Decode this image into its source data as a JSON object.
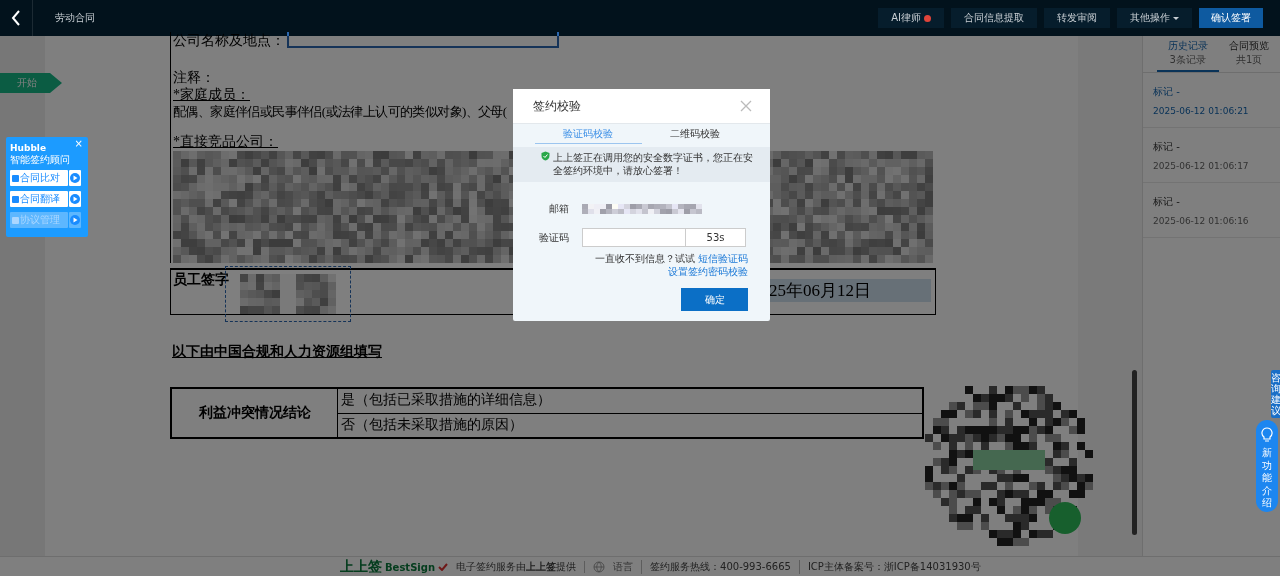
{
  "top_bar": {
    "title": "劳动合同",
    "buttons": [
      {
        "label": "AI律师",
        "kind": "ai"
      },
      {
        "label": "合同信息提取",
        "kind": "plain"
      },
      {
        "label": "转发审阅",
        "kind": "plain"
      },
      {
        "label": "其他操作",
        "kind": "dropdown"
      },
      {
        "label": "确认签署",
        "kind": "primary"
      }
    ]
  },
  "start_marker": "开始",
  "hubble": {
    "title": "Hubble",
    "close": "×",
    "subtitle": "智能签约顾问",
    "items": [
      {
        "label": "合同比对",
        "disabled": false
      },
      {
        "label": "合同翻译",
        "disabled": false
      },
      {
        "label": "协议管理",
        "disabled": true
      }
    ]
  },
  "document": {
    "company_label": "公司名称及地点：",
    "notes_label": "注释：",
    "family_heading": "*家庭成员：",
    "family_text": "配偶、家庭伴侣或民事伴侣(或法律上认可的类似对象)、父母(",
    "competitor_heading": "*直接竞品公司：",
    "signature_label": "员工签字",
    "sign_date": "25年06月12日",
    "section_heading": "以下由中国合规和人力资源组填写",
    "conflict_label": "利益冲突情况结论",
    "conflict_options": [
      "是（包括已采取措施的详细信息）",
      "否（包括未采取措施的原因）"
    ]
  },
  "history_panel": {
    "tabs": [
      {
        "label": "历史记录",
        "sub": "3条记录",
        "selected": true
      },
      {
        "label": "合同预览",
        "sub": "共1页",
        "selected": false
      }
    ],
    "entries": [
      {
        "label": "标记 -",
        "time": "2025-06-12 01:06:21",
        "selected": true
      },
      {
        "label": "标记 -",
        "time": "2025-06-12 01:06:17",
        "selected": false
      },
      {
        "label": "标记 -",
        "time": "2025-06-12 01:06:16",
        "selected": false
      }
    ]
  },
  "side_tabs": [
    {
      "label": "咨询建议",
      "kind": "small"
    },
    {
      "label": "新功能介绍",
      "kind": "feature"
    }
  ],
  "modal": {
    "title": "签约校验",
    "tabs": [
      {
        "label": "验证码校验",
        "selected": true
      },
      {
        "label": "二维码校验",
        "selected": false
      }
    ],
    "notice": "上上签正在调用您的安全数字证书，您正在安全签约环境中，请放心签署！",
    "email_label": "邮箱",
    "code_label": "验证码",
    "countdown": "53s",
    "help": "一直收不到信息？试试",
    "links": [
      "短信验证码",
      "设置签约密码校验"
    ],
    "confirm": "确定"
  },
  "footer": {
    "brand": "上上签",
    "brand_en": "BestSign",
    "provider": "电子签约服务由**上上签**提供",
    "language": "语言",
    "hotline": "签约服务热线：400-993-6665",
    "icp": "ICP主体备案号：浙ICP备14031930号"
  }
}
